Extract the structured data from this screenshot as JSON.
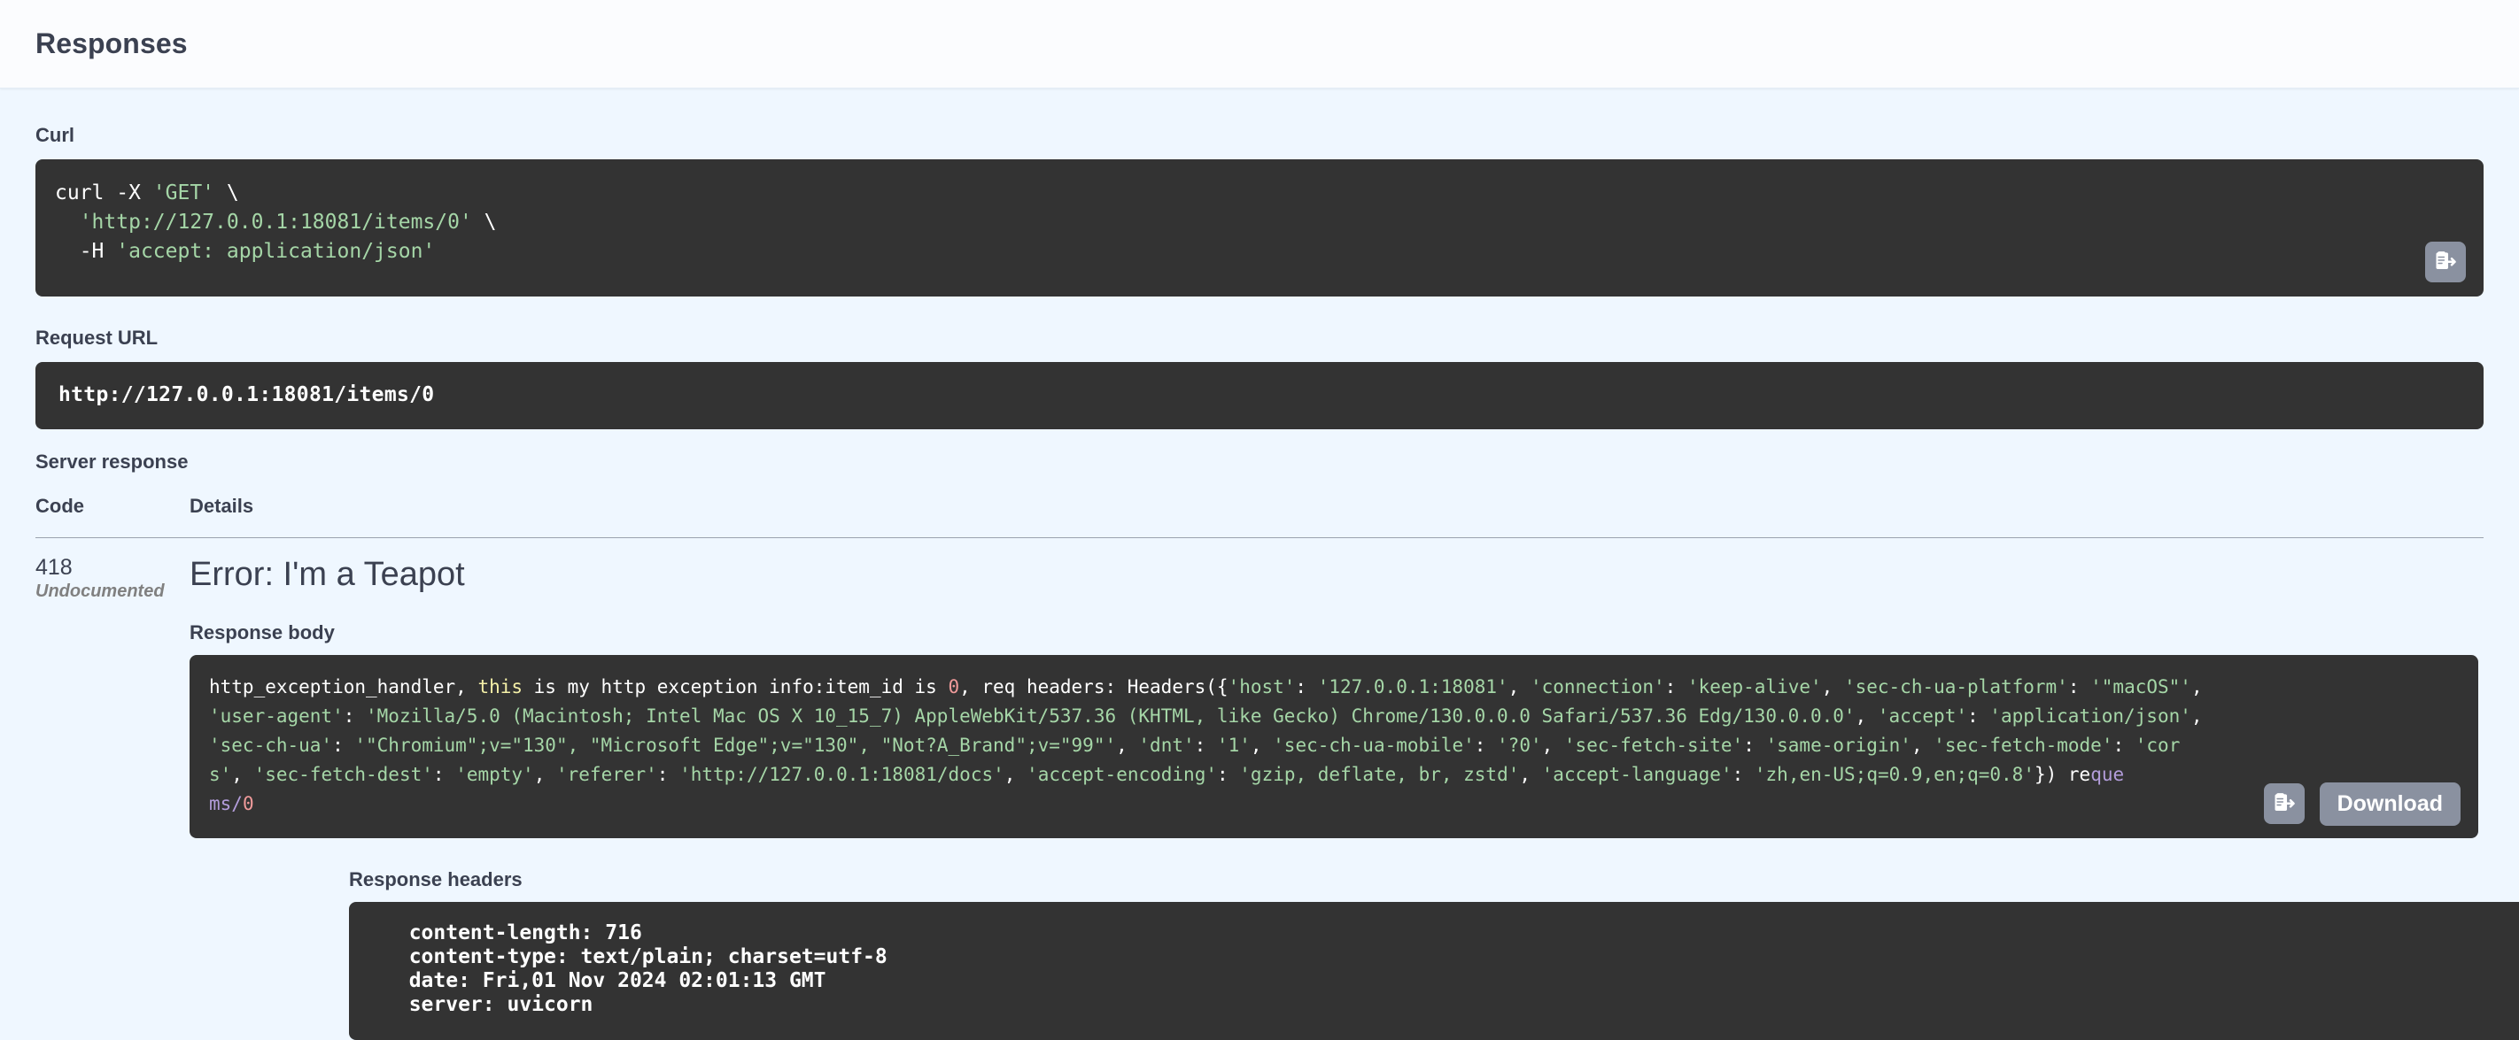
{
  "header": {
    "title": "Responses"
  },
  "curl": {
    "label": "Curl",
    "copy_icon": "copy-clipboard-icon",
    "lines": [
      {
        "segments": [
          {
            "text": "curl -X ",
            "kind": "plain"
          },
          {
            "text": "'GET'",
            "kind": "string"
          },
          {
            "text": " \\",
            "kind": "plain"
          }
        ]
      },
      {
        "segments": [
          {
            "text": "  ",
            "kind": "plain"
          },
          {
            "text": "'http://127.0.0.1:18081/items/0'",
            "kind": "string"
          },
          {
            "text": " \\",
            "kind": "plain"
          }
        ]
      },
      {
        "segments": [
          {
            "text": "  -H ",
            "kind": "plain"
          },
          {
            "text": "'accept: application/json'",
            "kind": "string"
          }
        ]
      }
    ],
    "text": "curl -X 'GET' \\\n  'http://127.0.0.1:18081/items/0' \\\n  -H 'accept: application/json'"
  },
  "request_url": {
    "label": "Request URL",
    "value": "http://127.0.0.1:18081/items/0"
  },
  "server_response": {
    "label": "Server response",
    "columns": {
      "code": "Code",
      "details": "Details"
    },
    "rows": [
      {
        "code": "418",
        "code_note": "Undocumented",
        "details_title": "Error: I'm a Teapot",
        "response_body_label": "Response body",
        "response_body_lines": [
          [
            {
              "text": "http_exception_handler, ",
              "kind": "plain"
            },
            {
              "text": "this",
              "kind": "keyword"
            },
            {
              "text": " is my http exception info:item_id is ",
              "kind": "plain"
            },
            {
              "text": "0",
              "kind": "number"
            },
            {
              "text": ", req headers: Headers({",
              "kind": "plain"
            },
            {
              "text": "'host'",
              "kind": "string"
            },
            {
              "text": ": ",
              "kind": "plain"
            },
            {
              "text": "'127.0.0.1:18081'",
              "kind": "string"
            },
            {
              "text": ", ",
              "kind": "plain"
            },
            {
              "text": "'connection'",
              "kind": "string"
            },
            {
              "text": ": ",
              "kind": "plain"
            },
            {
              "text": "'keep-alive'",
              "kind": "string"
            },
            {
              "text": ", ",
              "kind": "plain"
            },
            {
              "text": "'sec-ch-ua-platform'",
              "kind": "string"
            },
            {
              "text": ": ",
              "kind": "plain"
            },
            {
              "text": "'\"macOS\"'",
              "kind": "string"
            },
            {
              "text": ",",
              "kind": "plain"
            }
          ],
          [
            {
              "text": "'user-agent'",
              "kind": "string"
            },
            {
              "text": ": ",
              "kind": "plain"
            },
            {
              "text": "'Mozilla/5.0 (Macintosh; Intel Mac OS X 10_15_7) AppleWebKit/537.36 (KHTML, like Gecko) Chrome/130.0.0.0 Safari/537.36 Edg/130.0.0.0'",
              "kind": "string"
            },
            {
              "text": ", ",
              "kind": "plain"
            },
            {
              "text": "'accept'",
              "kind": "string"
            },
            {
              "text": ": ",
              "kind": "plain"
            },
            {
              "text": "'application/json'",
              "kind": "string"
            },
            {
              "text": ",",
              "kind": "plain"
            }
          ],
          [
            {
              "text": "'sec-ch-ua'",
              "kind": "string"
            },
            {
              "text": ": ",
              "kind": "plain"
            },
            {
              "text": "'\"Chromium\";v=\"130\", \"Microsoft Edge\";v=\"130\", \"Not?A_Brand\";v=\"99\"'",
              "kind": "string"
            },
            {
              "text": ", ",
              "kind": "plain"
            },
            {
              "text": "'dnt'",
              "kind": "string"
            },
            {
              "text": ": ",
              "kind": "plain"
            },
            {
              "text": "'1'",
              "kind": "string"
            },
            {
              "text": ", ",
              "kind": "plain"
            },
            {
              "text": "'sec-ch-ua-mobile'",
              "kind": "string"
            },
            {
              "text": ": ",
              "kind": "plain"
            },
            {
              "text": "'?0'",
              "kind": "string"
            },
            {
              "text": ", ",
              "kind": "plain"
            },
            {
              "text": "'sec-fetch-site'",
              "kind": "string"
            },
            {
              "text": ": ",
              "kind": "plain"
            },
            {
              "text": "'same-origin'",
              "kind": "string"
            },
            {
              "text": ", ",
              "kind": "plain"
            },
            {
              "text": "'sec-fetch-mode'",
              "kind": "string"
            },
            {
              "text": ": ",
              "kind": "plain"
            },
            {
              "text": "'cor",
              "kind": "string"
            }
          ],
          [
            {
              "text": "s'",
              "kind": "string"
            },
            {
              "text": ", ",
              "kind": "plain"
            },
            {
              "text": "'sec-fetch-dest'",
              "kind": "string"
            },
            {
              "text": ": ",
              "kind": "plain"
            },
            {
              "text": "'empty'",
              "kind": "string"
            },
            {
              "text": ", ",
              "kind": "plain"
            },
            {
              "text": "'referer'",
              "kind": "string"
            },
            {
              "text": ": ",
              "kind": "plain"
            },
            {
              "text": "'http://127.0.0.1:18081/docs'",
              "kind": "string"
            },
            {
              "text": ", ",
              "kind": "plain"
            },
            {
              "text": "'accept-encoding'",
              "kind": "string"
            },
            {
              "text": ": ",
              "kind": "plain"
            },
            {
              "text": "'gzip, deflate, br, zstd'",
              "kind": "string"
            },
            {
              "text": ", ",
              "kind": "plain"
            },
            {
              "text": "'accept-language'",
              "kind": "string"
            },
            {
              "text": ": ",
              "kind": "plain"
            },
            {
              "text": "'zh,en-US;q=0.9,en;q=0.8'",
              "kind": "string"
            },
            {
              "text": "}) re",
              "kind": "plain"
            },
            {
              "text": "que",
              "kind": "var"
            }
          ],
          [
            {
              "text": "ms/",
              "kind": "var"
            },
            {
              "text": "0",
              "kind": "number"
            }
          ]
        ],
        "copy_icon": "copy-clipboard-icon",
        "download_label": "Download",
        "response_headers_label": "Response headers",
        "response_headers": [
          "  content-length: 716",
          "  content-type: text/plain; charset=utf-8",
          "  date: Fri,01 Nov 2024 02:01:13 GMT",
          "  server: uvicorn"
        ]
      }
    ]
  },
  "colors": {
    "page_bg": "#eff7ff",
    "header_bg": "#fbfcfe",
    "code_bg": "#333333",
    "text": "#3b4151",
    "string": "#a5d6a7",
    "number": "#ef9a9a",
    "keyword": "#f5f0a8",
    "variable": "#b39ddb",
    "button_bg": "#8a91a0"
  }
}
